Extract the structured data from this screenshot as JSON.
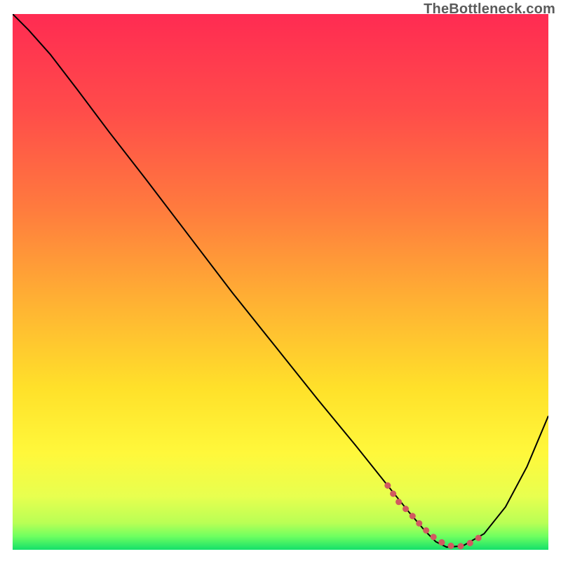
{
  "watermark": "TheBottleneck.com",
  "chart_data": {
    "type": "line",
    "title": "",
    "xlabel": "",
    "ylabel": "",
    "xlim": [
      0,
      100
    ],
    "ylim": [
      0,
      100
    ],
    "grid": false,
    "legend": false,
    "background_gradient_stops": [
      {
        "offset": 0.0,
        "color": "#ff2b52"
      },
      {
        "offset": 0.18,
        "color": "#ff4c4a"
      },
      {
        "offset": 0.36,
        "color": "#ff7a3e"
      },
      {
        "offset": 0.54,
        "color": "#ffb233"
      },
      {
        "offset": 0.7,
        "color": "#ffe12a"
      },
      {
        "offset": 0.82,
        "color": "#fff83b"
      },
      {
        "offset": 0.9,
        "color": "#e8ff4f"
      },
      {
        "offset": 0.95,
        "color": "#b9ff55"
      },
      {
        "offset": 0.975,
        "color": "#6fff60"
      },
      {
        "offset": 1.0,
        "color": "#14e06a"
      }
    ],
    "series": [
      {
        "name": "bottleneck-curve",
        "color": "#000000",
        "width": 2,
        "x": [
          0,
          3,
          7,
          12,
          18,
          25,
          33,
          41,
          49,
          57,
          64,
          70,
          74,
          77,
          79,
          81,
          84,
          88,
          92,
          96,
          100
        ],
        "values": [
          100,
          97,
          92.5,
          86,
          78,
          69,
          58.5,
          48,
          38,
          28,
          19.5,
          12,
          7,
          3.5,
          1.5,
          0.5,
          0.7,
          3,
          8,
          15.5,
          25
        ]
      },
      {
        "name": "highlight-segment",
        "color": "#d15a60",
        "width": 9,
        "linecap": "round",
        "dash": "0.1 14",
        "x": [
          70,
          72,
          74,
          76,
          78,
          79.5,
          81,
          82.5,
          84,
          86,
          88
        ],
        "values": [
          12,
          9,
          7,
          4.8,
          2.8,
          1.7,
          0.9,
          0.6,
          0.7,
          1.5,
          3
        ]
      }
    ]
  }
}
